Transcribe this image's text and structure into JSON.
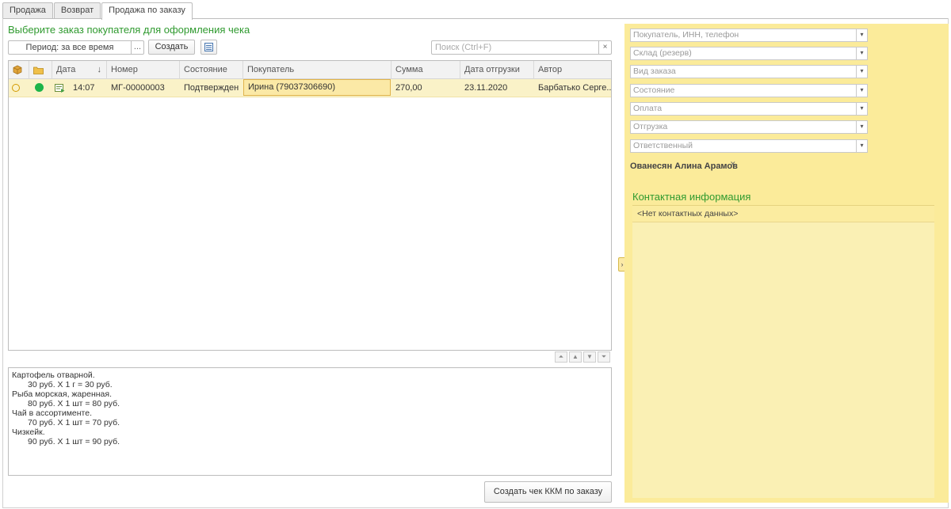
{
  "tabs": [
    "Продажа",
    "Возврат",
    "Продажа по заказу"
  ],
  "title": "Выберите заказ покупателя для оформления чека",
  "toolbar": {
    "period": "Период: за все время",
    "dots": "...",
    "create": "Создать",
    "search_placeholder": "Поиск (Ctrl+F)",
    "search_clear": "×"
  },
  "grid": {
    "headers": {
      "date": "Дата",
      "sort_arrow": "↓",
      "number": "Номер",
      "state": "Состояние",
      "buyer": "Покупатель",
      "sum": "Сумма",
      "ship_date": "Дата отгрузки",
      "author": "Автор"
    },
    "rows": [
      {
        "time": "14:07",
        "number": "МГ-00000003",
        "state": "Подтвержден",
        "buyer": "Ирина (79037306690)",
        "sum": "270,00",
        "ship_date": "23.11.2020",
        "author": "Барбатько Серге..."
      }
    ]
  },
  "details": {
    "lines": [
      "Картофель отварной.",
      "30 руб. X 1 г = 30 руб.",
      "Рыба морская, жаренная.",
      "80 руб. X 1 шт = 80 руб.",
      "Чай в ассортименте.",
      "70 руб. X 1 шт = 70 руб.",
      "Чизкейк.",
      "90 руб. X 1 шт = 90 руб."
    ]
  },
  "create_check": "Создать чек ККМ по заказу",
  "filters": {
    "buyer": "Покупатель, ИНН, телефон",
    "warehouse": "Склад (резерв)",
    "order_type": "Вид заказа",
    "state": "Состояние",
    "payment": "Оплата",
    "shipment": "Отгрузка",
    "responsible": "Ответственный"
  },
  "responsible_user": "Ованесян Алина Арамов",
  "contact": {
    "title": "Контактная информация",
    "empty": "<Нет контактных данных>"
  },
  "colors": {
    "title_green": "#2f9a2f",
    "panel_yellow": "#fbeb9a",
    "row_selected": "#faf2c8",
    "status_green": "#1db44a"
  }
}
